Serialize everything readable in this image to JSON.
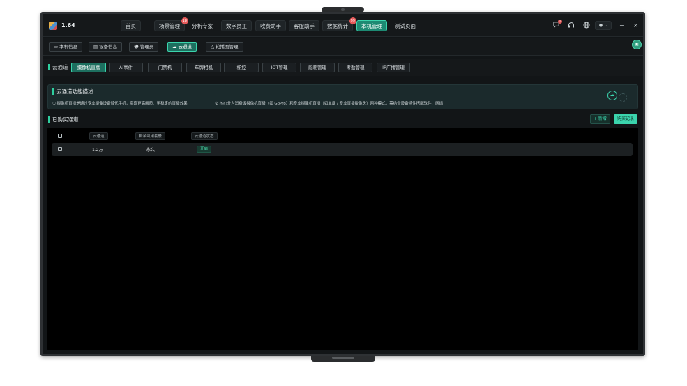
{
  "app": {
    "version": "1.64"
  },
  "nav": {
    "tabs": [
      {
        "label": "首页",
        "badge": null
      },
      {
        "label": "场景管理",
        "badge": "18"
      },
      {
        "label": "分析专家",
        "badge": null
      },
      {
        "label": "数字员工",
        "badge": null
      },
      {
        "label": "收费助手",
        "badge": null
      },
      {
        "label": "客服助手",
        "badge": null
      },
      {
        "label": "数据统计",
        "badge": "99"
      },
      {
        "label": "本机管理",
        "badge": null
      },
      {
        "label": "测试页面",
        "badge": null
      }
    ],
    "active": "本机管理",
    "message_badge": "1",
    "minimize": "−",
    "close": "×"
  },
  "subnav": {
    "tabs": [
      {
        "label": "本机信息",
        "icon": "monitor-icon"
      },
      {
        "label": "设备信息",
        "icon": "device-icon"
      },
      {
        "label": "管理员",
        "icon": "user-icon"
      },
      {
        "label": "云通道",
        "icon": "cloud-icon"
      },
      {
        "label": "轮播图管理",
        "icon": "image-icon"
      }
    ],
    "active": "云通道"
  },
  "section": {
    "title": "云通道",
    "tabs": [
      "摄像机直播",
      "AI事件",
      "门禁机",
      "车牌相机",
      "梯控",
      "IOT管理",
      "能耗管理",
      "考勤管理",
      "IP广播管理"
    ],
    "active": "摄像机直播"
  },
  "description": {
    "title": "云通道功能描述",
    "point1": "① 摄像机直播是通过专业摄像设备替代手机，实现更高画质、更稳定的直播效果",
    "point2": "② 核心分为消费级摄像机直播（如 GoPro）和专业摄像机直播（如单反 / 专业直播摄像头）两种模式，需结合设备特性搭配软件、网络"
  },
  "purchased": {
    "title": "已购买通道",
    "add_label": "+ 新增",
    "records_label": "购买记录",
    "columns": [
      "云通道",
      "剩余可用套餐",
      "云通道状态"
    ],
    "rows": [
      {
        "channel": "1.2万",
        "remaining": "永久",
        "status": "开启"
      }
    ]
  },
  "colors": {
    "accent": "#3bd4ad",
    "active_tab": "#1d8a73",
    "badge": "#e65a5a"
  }
}
